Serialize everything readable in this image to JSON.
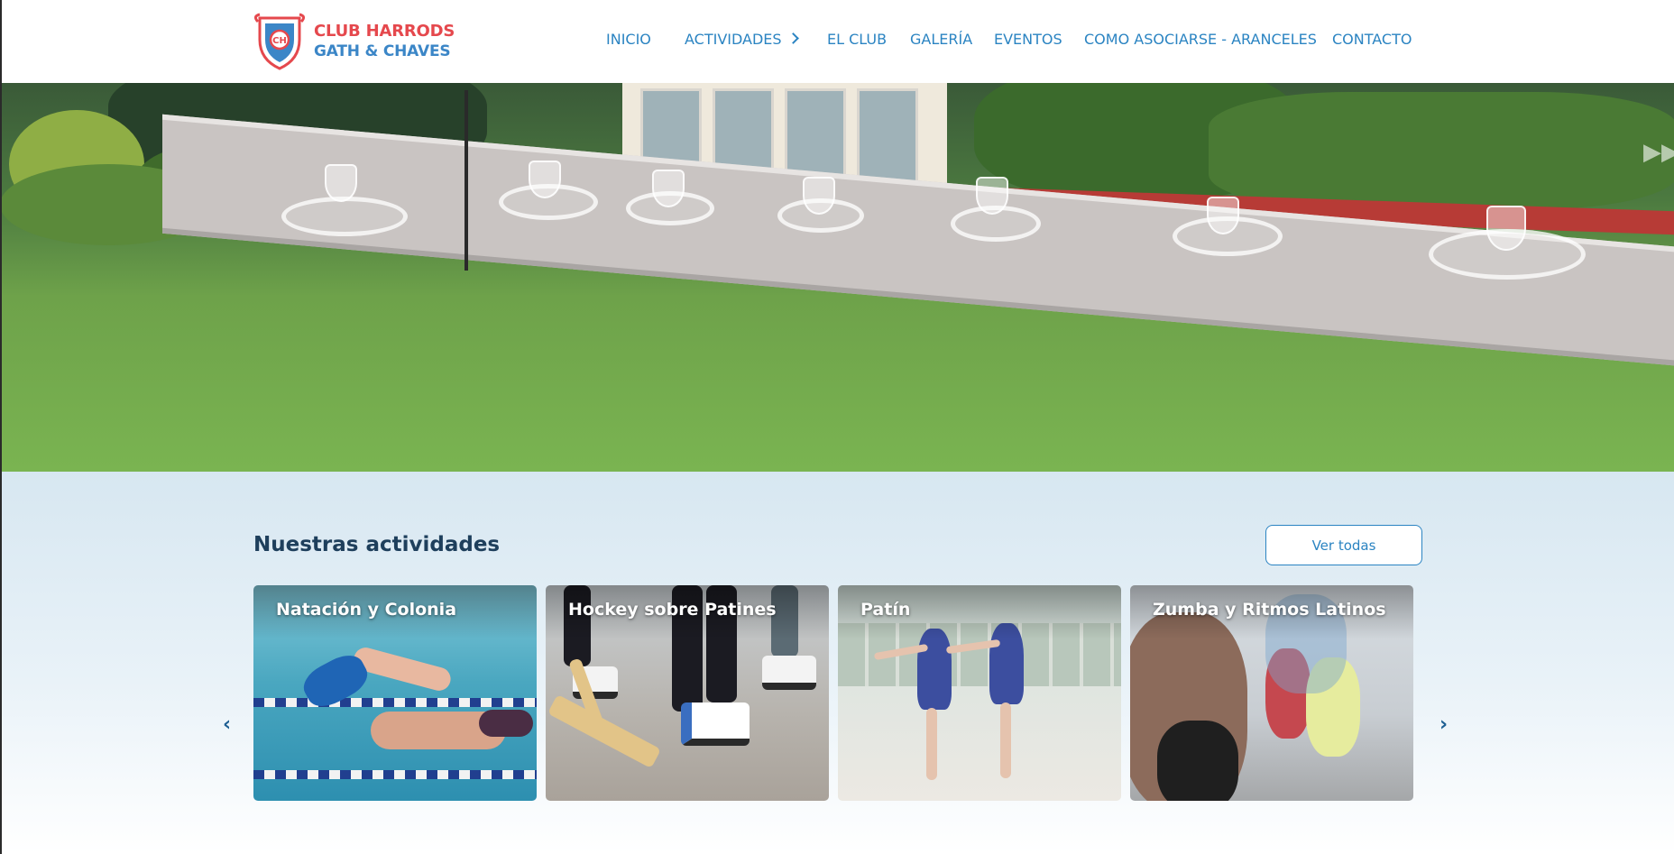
{
  "header": {
    "logo": {
      "line1": "CLUB HARRODS",
      "line2": "GATH & CHAVES"
    },
    "nav": [
      {
        "label": "INICIO"
      },
      {
        "label": "ACTIVIDADES"
      },
      {
        "label": "EL CLUB"
      },
      {
        "label": "GALERÍA"
      },
      {
        "label": "EVENTOS"
      },
      {
        "label": "COMO ASOCIARSE - ARANCELES"
      },
      {
        "label": "CONTACTO"
      }
    ]
  },
  "hero": {
    "skip_icon": "fast-forward-icon"
  },
  "activities": {
    "title": "Nuestras actividades",
    "view_all_label": "Ver todas",
    "cards": [
      {
        "title": "Natación y Colonia"
      },
      {
        "title": "Hockey sobre Patines"
      },
      {
        "title": "Patín"
      },
      {
        "title": "Zumba y Ritmos Latinos"
      }
    ],
    "prev_icon": "chevron-left-icon",
    "next_icon": "chevron-right-icon"
  },
  "colors": {
    "brand_red": "#e5484d",
    "brand_blue": "#2b84c2",
    "title_navy": "#1e3f5c",
    "section_bg": "#d7e7f1"
  }
}
